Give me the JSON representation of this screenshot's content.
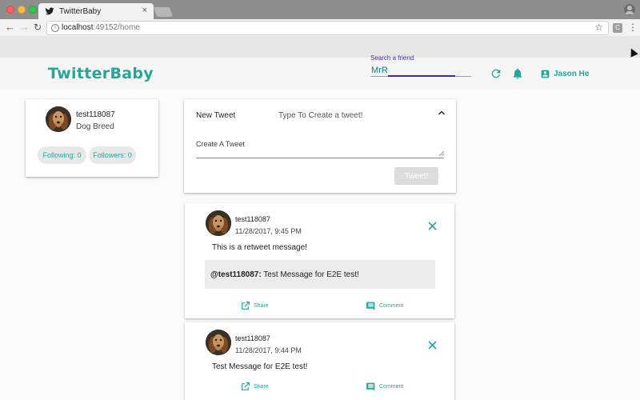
{
  "browser": {
    "tab_title": "TwitterBaby",
    "tab_close": "×",
    "url_host": "localhost",
    "url_path": ":49152/home",
    "menu_glyph": "⋮",
    "extension_letter": "C"
  },
  "app": {
    "brand": "TwitterBaby",
    "accent": "#26a69a",
    "search": {
      "label": "Search a friend",
      "value": "MrR"
    },
    "user_name": "Jason He",
    "icons": [
      "refresh-icon",
      "bell-icon",
      "account-box-icon"
    ]
  },
  "profile": {
    "username": "test118087",
    "subtitle": "Dog Breed",
    "following": "Following: 0",
    "followers": "Followers: 0"
  },
  "compose": {
    "title": "New Tweet",
    "hint": "Type To Create a tweet!",
    "field_label": "Create A Tweet",
    "submit": "Tweet!"
  },
  "tweets": [
    {
      "username": "test118087",
      "date": "11/28/2017, 9:45 PM",
      "text": "This is a retweet message!",
      "quote_user": "@test118087:",
      "quote_text": " Test Message for E2E test!",
      "share": "Share",
      "comment": "Comment"
    },
    {
      "username": "test118087",
      "date": "11/28/2017, 9:44 PM",
      "text": "Test Message for E2E test!",
      "share": "Share",
      "comment": "Comment"
    }
  ]
}
